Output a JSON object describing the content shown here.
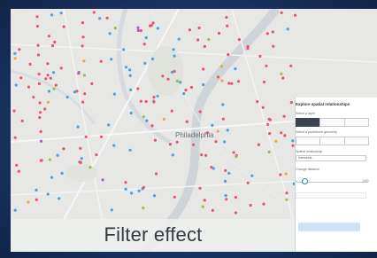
{
  "caption": {
    "text": "Filter effect"
  },
  "panel": {
    "title": "Explore spatial relationships",
    "select_layer_label": "Select a layer",
    "layer_options": [
      "",
      "",
      ""
    ],
    "geometry_label": "Select a predefined geometry",
    "geometry_options": [
      "",
      "",
      ""
    ],
    "relationship_label": "Spatial relationship",
    "relationship_value": "intersects",
    "distance_label": "Change distance",
    "distance_min": "0",
    "distance_max": "1000",
    "distance_fraction": 0.1,
    "units_value": "",
    "apply_label": ""
  },
  "map": {
    "place_label": "Philadelphia",
    "point_colors": [
      "#e5566c",
      "#4b9fe1",
      "#8fc44a",
      "#f0a640",
      "#a85bc9"
    ]
  }
}
